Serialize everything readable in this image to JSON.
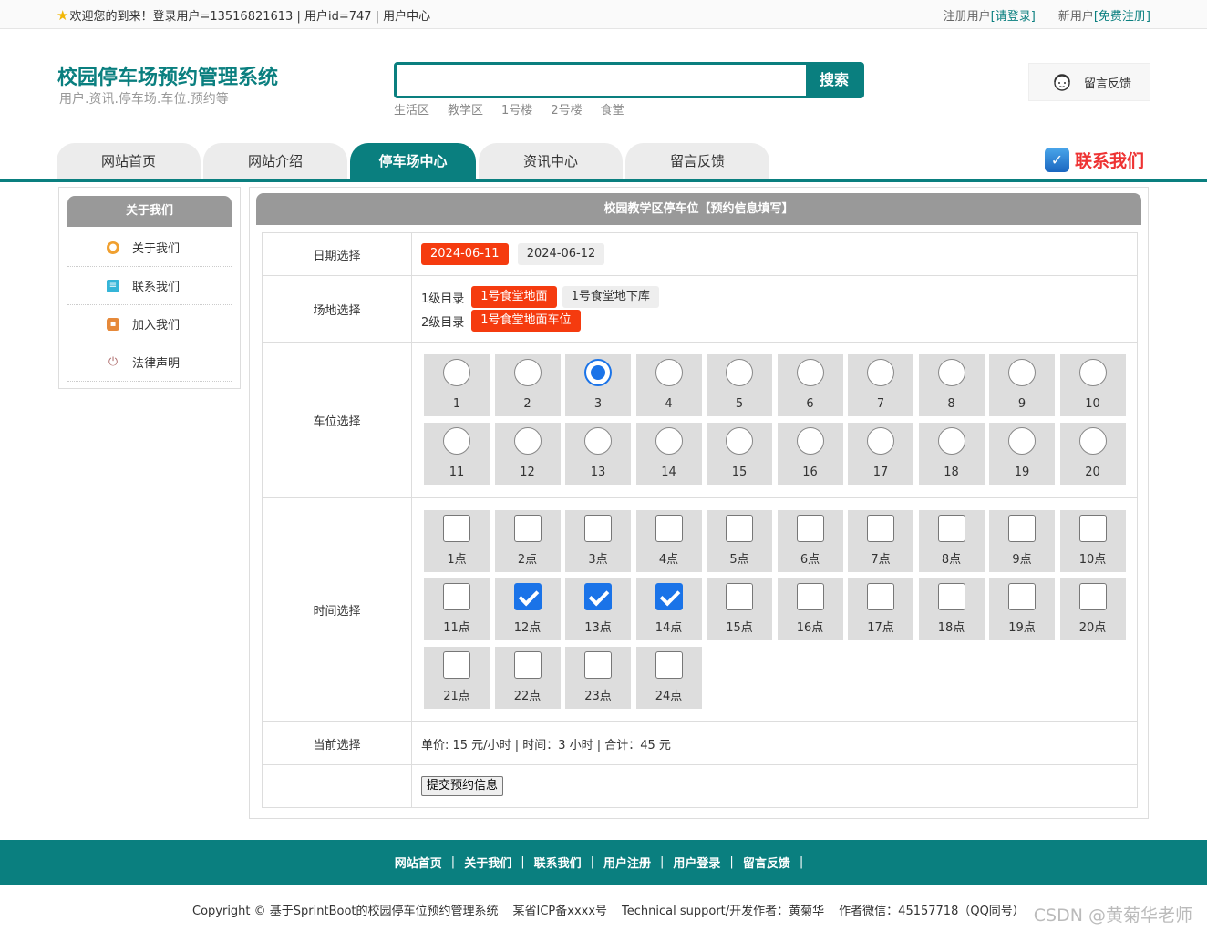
{
  "topbar": {
    "welcome": "欢迎您的到来！登录用户=13516821613 | 用户id=747 | 用户中心",
    "register_user_label": "注册用户",
    "login_link": "[请登录]",
    "new_user_label": "新用户",
    "register_link": "[免费注册]"
  },
  "header": {
    "title": "校园停车场预约管理系统",
    "subtitle": "用户.资讯.停车场.车位.预约等",
    "search_value": "",
    "search_button": "搜索",
    "hotwords": [
      "生活区",
      "教学区",
      "1号楼",
      "2号楼",
      "食堂"
    ],
    "feedback": "留言反馈"
  },
  "nav": {
    "tabs": [
      "网站首页",
      "网站介绍",
      "停车场中心",
      "资讯中心",
      "留言反馈"
    ],
    "active_index": 2,
    "contact": "联系我们"
  },
  "sidebar": {
    "title": "关于我们",
    "items": [
      {
        "label": "关于我们",
        "icon": "about-icon",
        "color": "#f0a030"
      },
      {
        "label": "联系我们",
        "icon": "clipboard-icon",
        "color": "#35b5d8"
      },
      {
        "label": "加入我们",
        "icon": "lock-icon",
        "color": "#e6893a"
      },
      {
        "label": "法律声明",
        "icon": "power-icon",
        "color": "#b07070"
      }
    ]
  },
  "main": {
    "title": "校园教学区停车位【预约信息填写】",
    "rows": {
      "date_label": "日期选择",
      "venue_label": "场地选择",
      "spot_label": "车位选择",
      "time_label": "时间选择",
      "current_label": "当前选择"
    },
    "dates": [
      {
        "label": "2024-06-11",
        "selected": true
      },
      {
        "label": "2024-06-12",
        "selected": false
      }
    ],
    "level1": {
      "label": "1级目录",
      "options": [
        {
          "label": "1号食堂地面",
          "selected": true
        },
        {
          "label": "1号食堂地下库",
          "selected": false
        }
      ]
    },
    "level2": {
      "label": "2级目录",
      "options": [
        {
          "label": "1号食堂地面车位",
          "selected": true
        }
      ]
    },
    "spots": [
      "1",
      "2",
      "3",
      "4",
      "5",
      "6",
      "7",
      "8",
      "9",
      "10",
      "11",
      "12",
      "13",
      "14",
      "15",
      "16",
      "17",
      "18",
      "19",
      "20"
    ],
    "selected_spot": "3",
    "hours": [
      "1点",
      "2点",
      "3点",
      "4点",
      "5点",
      "6点",
      "7点",
      "8点",
      "9点",
      "10点",
      "11点",
      "12点",
      "13点",
      "14点",
      "15点",
      "16点",
      "17点",
      "18点",
      "19点",
      "20点",
      "21点",
      "22点",
      "23点",
      "24点"
    ],
    "selected_hours": [
      "12点",
      "13点",
      "14点"
    ],
    "summary": "单价: 15 元/小时 | 时间：3 小时 | 合计：45 元",
    "submit_button": "提交预约信息"
  },
  "footer": {
    "links": [
      "网站首页",
      "关于我们",
      "联系我们",
      "用户注册",
      "用户登录",
      "留言反馈"
    ],
    "copyright": "Copyright © 基于SprintBoot的校园停车位预约管理系统",
    "icp": "某省ICP备xxxx号",
    "support": "Technical support/开发作者：黄菊华",
    "wechat": "作者微信：45157718（QQ同号）",
    "watermark": "CSDN @黄菊华老师"
  },
  "colors": {
    "brand": "#0a7f7f",
    "selected_orange": "#f53b0f",
    "check_blue": "#1a73e8"
  }
}
